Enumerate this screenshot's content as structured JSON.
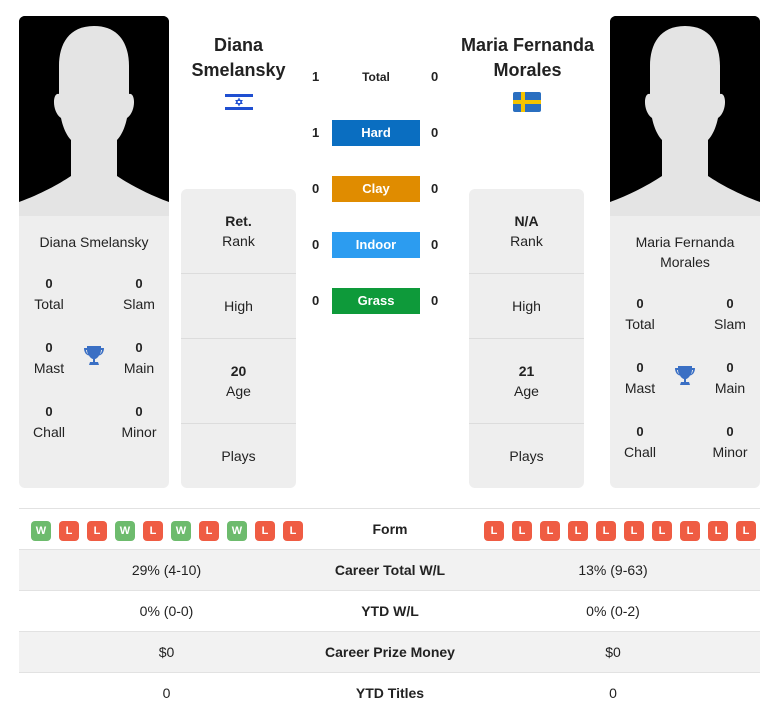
{
  "player1": {
    "name": "Diana Smelansky",
    "heading_line1": "Diana",
    "heading_line2": "Smelansky",
    "flag": "israel-flag",
    "titles": {
      "total": "0",
      "slam": "0",
      "mast": "0",
      "main": "0",
      "chall": "0",
      "minor": "0",
      "labels": {
        "total": "Total",
        "slam": "Slam",
        "mast": "Mast",
        "main": "Main",
        "chall": "Chall",
        "minor": "Minor"
      }
    },
    "stats": {
      "rank_value": "Ret.",
      "rank_label": "Rank",
      "high_label": "High",
      "age_value": "20",
      "age_label": "Age",
      "plays_label": "Plays"
    },
    "form": [
      "W",
      "L",
      "L",
      "W",
      "L",
      "W",
      "L",
      "W",
      "L",
      "L"
    ]
  },
  "player2": {
    "name": "Maria Fernanda Morales",
    "name_line1": "Maria Fernanda",
    "name_line2": "Morales",
    "heading_line1": "Maria Fernanda",
    "heading_line2": "Morales",
    "flag": "sweden-flag",
    "titles": {
      "total": "0",
      "slam": "0",
      "mast": "0",
      "main": "0",
      "chall": "0",
      "minor": "0",
      "labels": {
        "total": "Total",
        "slam": "Slam",
        "mast": "Mast",
        "main": "Main",
        "chall": "Chall",
        "minor": "Minor"
      }
    },
    "stats": {
      "rank_value": "N/A",
      "rank_label": "Rank",
      "high_label": "High",
      "age_value": "21",
      "age_label": "Age",
      "plays_label": "Plays"
    },
    "form": [
      "L",
      "L",
      "L",
      "L",
      "L",
      "L",
      "L",
      "L",
      "L",
      "L"
    ]
  },
  "h2h": [
    {
      "label": "Total",
      "p1": "1",
      "p2": "0",
      "color": ""
    },
    {
      "label": "Hard",
      "p1": "1",
      "p2": "0",
      "color": "#0a6ec1"
    },
    {
      "label": "Clay",
      "p1": "0",
      "p2": "0",
      "color": "#e08c00"
    },
    {
      "label": "Indoor",
      "p1": "0",
      "p2": "0",
      "color": "#2c9cf0"
    },
    {
      "label": "Grass",
      "p1": "0",
      "p2": "0",
      "color": "#0e9a3a"
    }
  ],
  "colors": {
    "win": "#6dbb6d",
    "loss": "#ef5c43",
    "trophy": "#3a6fc4"
  },
  "table": {
    "form_label": "Form",
    "rows": [
      {
        "label": "Career Total W/L",
        "p1": "29% (4-10)",
        "p2": "13% (9-63)"
      },
      {
        "label": "YTD W/L",
        "p1": "0% (0-0)",
        "p2": "0% (0-2)"
      },
      {
        "label": "Career Prize Money",
        "p1": "$0",
        "p2": "$0"
      },
      {
        "label": "YTD Titles",
        "p1": "0",
        "p2": "0"
      }
    ]
  }
}
